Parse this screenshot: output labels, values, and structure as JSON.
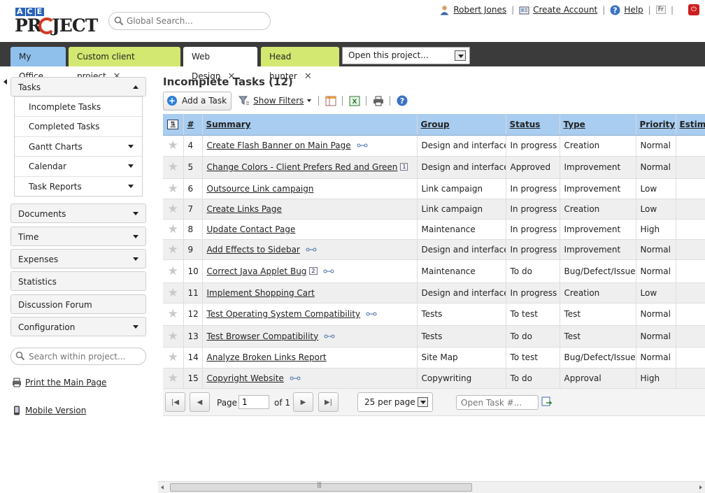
{
  "header": {
    "logo": "ACE PROJECT",
    "search_placeholder": "Global Search...",
    "user_name": "Robert Jones",
    "create_account": "Create Account",
    "help": "Help",
    "language": "Fr"
  },
  "tabs": {
    "my_office": "My Office",
    "custom_client": "Custom client project",
    "web_design": "Web Design",
    "head_hunter": "Head hunter",
    "open_project": "Open this project..."
  },
  "sidebar": {
    "tasks": "Tasks",
    "task_items": [
      {
        "label": "Incomplete Tasks"
      },
      {
        "label": "Completed Tasks"
      },
      {
        "label": "Gantt Charts"
      },
      {
        "label": "Calendar"
      },
      {
        "label": "Task Reports"
      }
    ],
    "documents": "Documents",
    "time": "Time",
    "expenses": "Expenses",
    "statistics": "Statistics",
    "discussion_forum": "Discussion Forum",
    "configuration": "Configuration",
    "search_placeholder": "Search within project...",
    "print_main": "Print the Main Page",
    "mobile_version": "Mobile Version"
  },
  "main": {
    "title": "Incomplete Tasks (12)",
    "add_task": "Add a Task",
    "show_filters": "Show Filters"
  },
  "grid": {
    "columns": {
      "num": "#",
      "summary": "Summary",
      "group": "Group",
      "status": "Status",
      "type": "Type",
      "priority": "Priority",
      "estimate": "Estima"
    },
    "rows": [
      {
        "num": "4",
        "summary": "Create Flash Banner on Main Page",
        "badge": "",
        "group": "Design and interface",
        "status": "In progress",
        "type": "Creation",
        "priority": "Normal"
      },
      {
        "num": "5",
        "summary": "Change Colors - Client Prefers Red and Green",
        "badge": "1",
        "group": "Design and interface",
        "status": "Approved",
        "type": "Improvement",
        "priority": "Normal"
      },
      {
        "num": "6",
        "summary": "Outsource Link campaign",
        "badge": "",
        "group": "Link campaign",
        "status": "In progress",
        "type": "Improvement",
        "priority": "Low"
      },
      {
        "num": "7",
        "summary": "Create Links Page",
        "badge": "",
        "group": "Link campaign",
        "status": "In progress",
        "type": "Creation",
        "priority": "Low"
      },
      {
        "num": "8",
        "summary": "Update Contact Page",
        "badge": "",
        "group": "Maintenance",
        "status": "In progress",
        "type": "Improvement",
        "priority": "High"
      },
      {
        "num": "9",
        "summary": "Add Effects to Sidebar",
        "badge": "",
        "group": "Design and interface",
        "status": "In progress",
        "type": "Improvement",
        "priority": "Normal"
      },
      {
        "num": "10",
        "summary": "Correct Java Applet Bug",
        "badge": "2",
        "group": "Maintenance",
        "status": "To do",
        "type": "Bug/Defect/Issue",
        "priority": "Normal"
      },
      {
        "num": "11",
        "summary": "Implement Shopping Cart",
        "badge": "",
        "group": "Design and interface",
        "status": "In progress",
        "type": "Creation",
        "priority": "Low"
      },
      {
        "num": "12",
        "summary": "Test Operating System Compatibility",
        "badge": "",
        "group": "Tests",
        "status": "To test",
        "type": "Test",
        "priority": "Normal"
      },
      {
        "num": "13",
        "summary": "Test Browser Compatibility",
        "badge": "",
        "group": "Tests",
        "status": "To do",
        "type": "Test",
        "priority": "Normal"
      },
      {
        "num": "14",
        "summary": "Analyze Broken Links Report",
        "badge": "",
        "group": "Site Map",
        "status": "To test",
        "type": "Bug/Defect/Issue",
        "priority": "Normal"
      },
      {
        "num": "15",
        "summary": "Copyright Website",
        "badge": "",
        "group": "Copywriting",
        "status": "To do",
        "type": "Approval",
        "priority": "High"
      }
    ]
  },
  "pager": {
    "page_label": "Page",
    "page_value": "1",
    "of_label": "of 1",
    "per_page": "25 per page",
    "open_task_placeholder": "Open Task #..."
  },
  "colors": {
    "tab_blue": "#8fbfeb",
    "tab_green": "#d3e870",
    "grid_header": "#a8cdf0",
    "tab_bar": "#3b3b3b"
  }
}
